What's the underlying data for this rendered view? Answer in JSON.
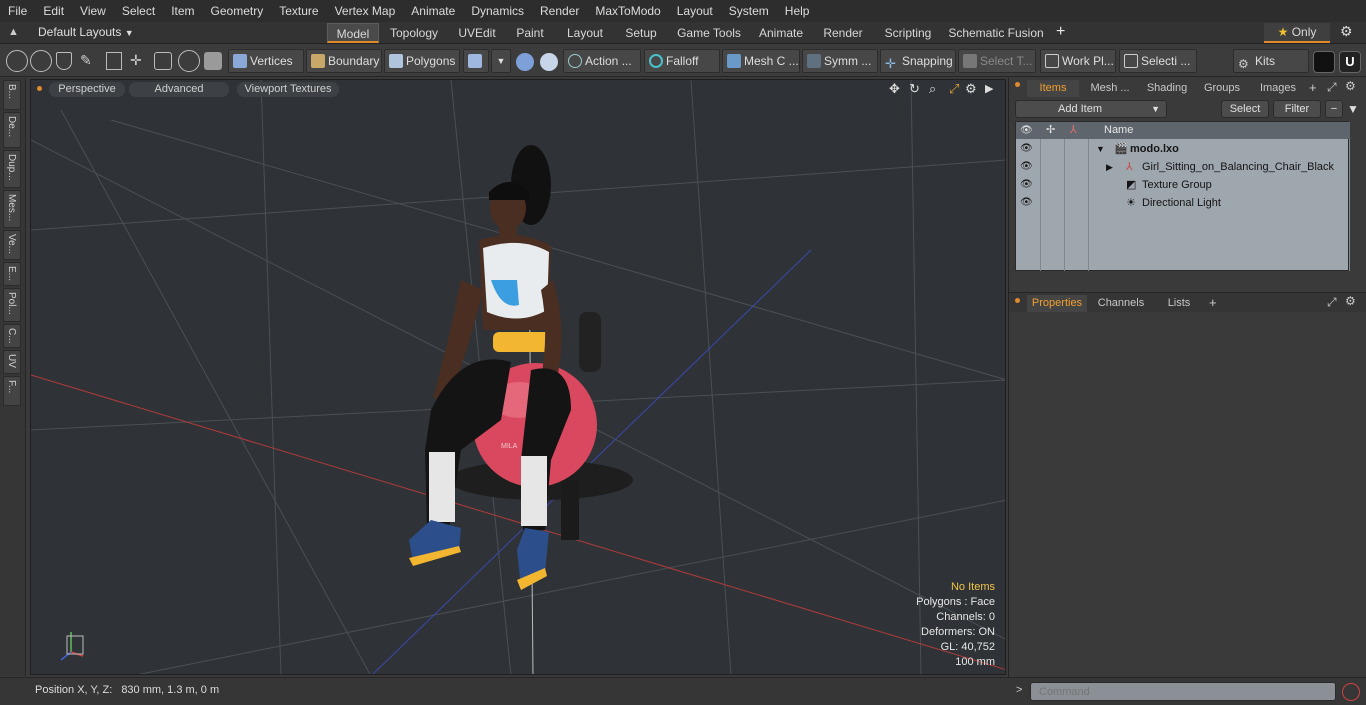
{
  "menu": [
    "File",
    "Edit",
    "View",
    "Select",
    "Item",
    "Geometry",
    "Texture",
    "Vertex Map",
    "Animate",
    "Dynamics",
    "Render",
    "MaxToModo",
    "Layout",
    "System",
    "Help"
  ],
  "layoutbar": {
    "layout_selector": "Default Layouts",
    "tabs": [
      "Model",
      "Topology",
      "UVEdit",
      "Paint",
      "Layout",
      "Setup",
      "Game Tools",
      "Animate",
      "Render",
      "Scripting",
      "Schematic Fusion"
    ],
    "active_tab": "Model",
    "add": "+",
    "only": "Only"
  },
  "toolbar": {
    "vertices": "Vertices",
    "boundary": "Boundary",
    "polygons": "Polygons",
    "action": "Action",
    "falloff": "Falloff",
    "mesh_c": "Mesh C ...",
    "symm": "Symm ...",
    "snapping": "Snapping",
    "select_t": "Select T...",
    "work_pl": "Work Pl...",
    "selecti": "Selecti ...",
    "kits": "Kits"
  },
  "left_strip": [
    "B...",
    "De...",
    "Dup...",
    "Mes...",
    "Ve...",
    "E...",
    "Pol...",
    "C...",
    "UV",
    "F..."
  ],
  "viewport": {
    "tabs": [
      "Perspective",
      "Advanced",
      "Viewport Textures"
    ],
    "info": {
      "selection": "No Items",
      "polygons": "Polygons : Face",
      "channels": "Channels: 0",
      "deformers": "Deformers: ON",
      "gl": "GL: 40,752",
      "scale": "100 mm"
    },
    "chair_label": "MILA"
  },
  "status": {
    "label": "Position X, Y, Z:",
    "value": "830 mm, 1.3 m, 0 m"
  },
  "items_panel": {
    "tabs": [
      "Items",
      "Mesh ...",
      "Shading",
      "Groups",
      "Images"
    ],
    "active_tab": "Items",
    "add_item": "Add Item",
    "select": "Select",
    "filter": "Filter",
    "column_name": "Name",
    "rows": [
      {
        "label": "modo.lxo",
        "indent": 0,
        "bold": true
      },
      {
        "label": "Girl_Sitting_on_Balancing_Chair_Black",
        "indent": 1,
        "bold": false
      },
      {
        "label": "Texture Group",
        "indent": 1,
        "bold": false
      },
      {
        "label": "Directional Light",
        "indent": 1,
        "bold": false
      }
    ]
  },
  "properties_panel": {
    "tabs": [
      "Properties",
      "Channels",
      "Lists"
    ],
    "active_tab": "Properties"
  },
  "command": {
    "placeholder": "Command"
  },
  "colors": {
    "accent": "#e08a2a",
    "viewport_bg": "#2f3337",
    "list_bg": "#9ea6ae",
    "info_highlight": "#f2c34a"
  }
}
